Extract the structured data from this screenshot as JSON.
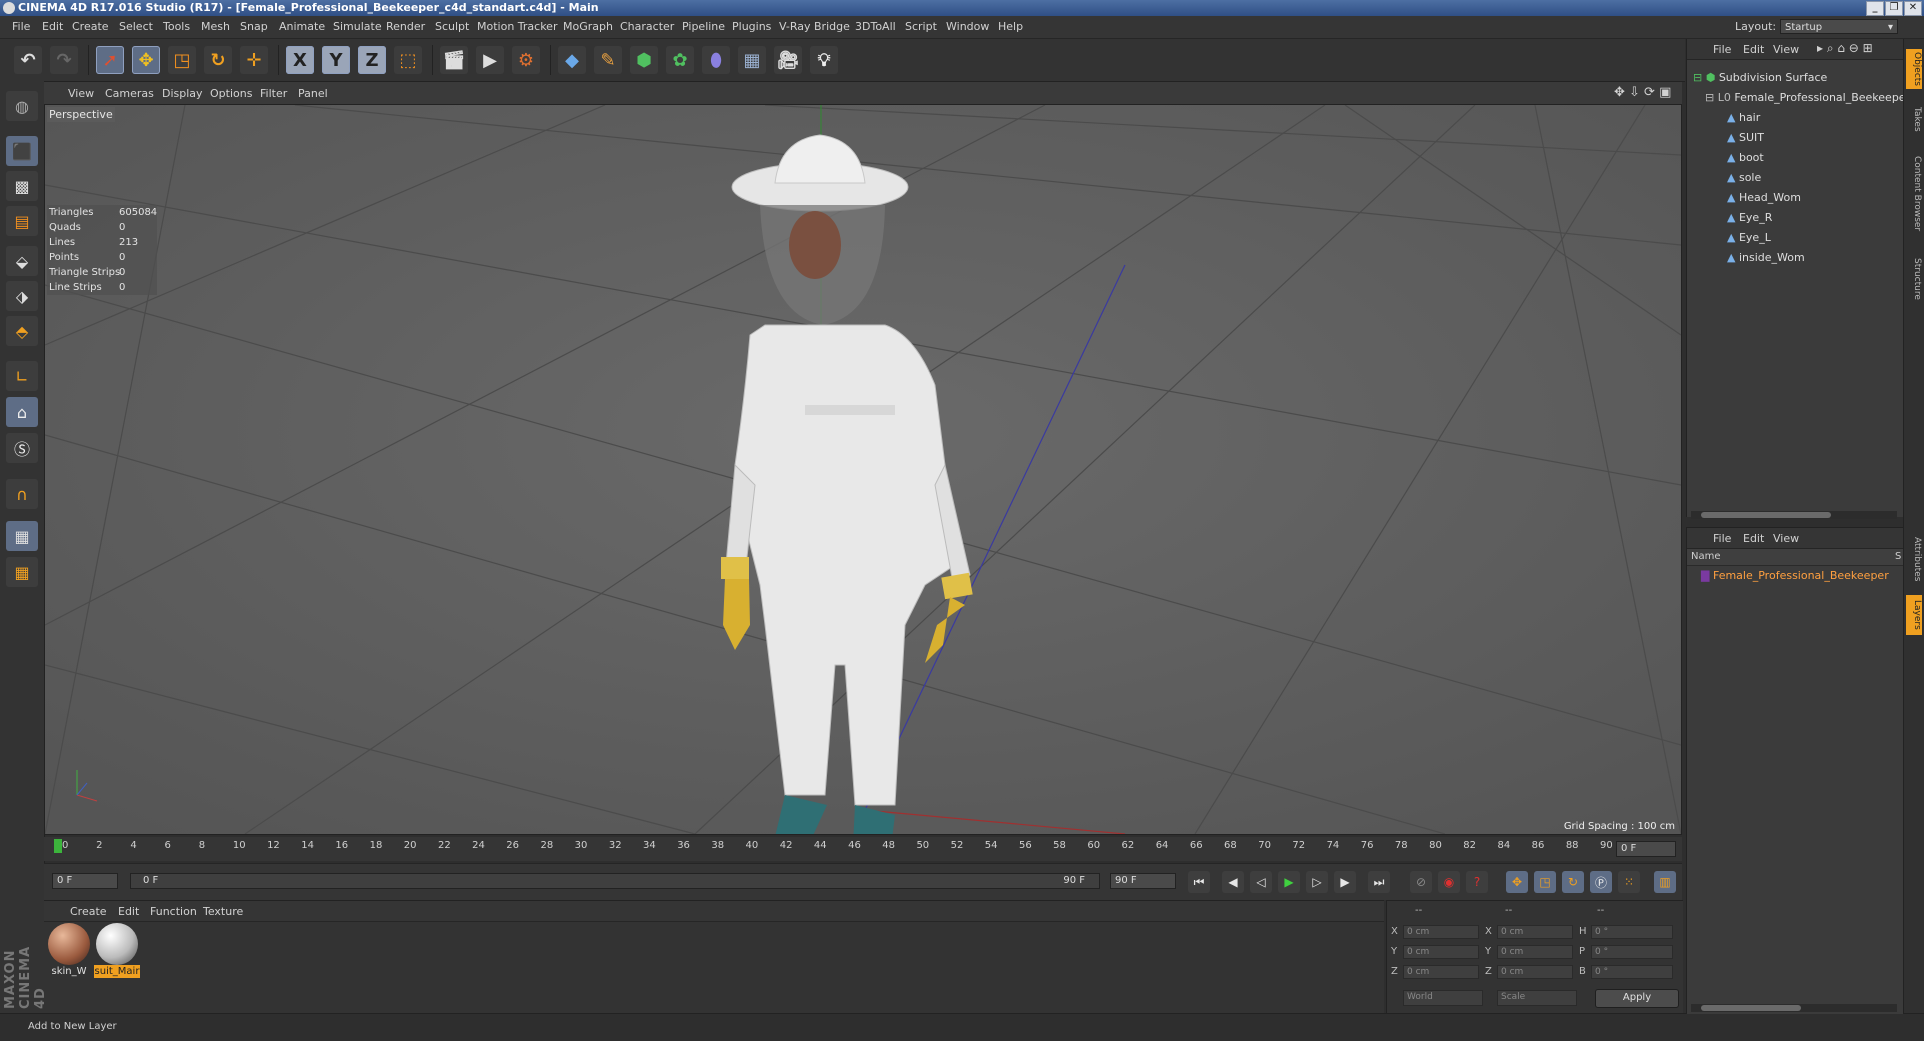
{
  "window": {
    "title": "CINEMA 4D R17.016 Studio (R17) - [Female_Professional_Beekeeper_c4d_standart.c4d] - Main",
    "buttons": [
      "_",
      "❐",
      "✕"
    ]
  },
  "menubar": {
    "items": [
      "File",
      "Edit",
      "Create",
      "Select",
      "Tools",
      "Mesh",
      "Snap",
      "Animate",
      "Simulate",
      "Render",
      "Sculpt",
      "Motion Tracker",
      "MoGraph",
      "Character",
      "Pipeline",
      "Plugins",
      "V-Ray Bridge",
      "3DToAll",
      "Script",
      "Window",
      "Help"
    ],
    "layout_label": "Layout:",
    "layout_value": "Startup"
  },
  "toolbar": {
    "axis_x": "X",
    "axis_y": "Y",
    "axis_z": "Z"
  },
  "viewport": {
    "menu": [
      "View",
      "Cameras",
      "Display",
      "Options",
      "Filter",
      "Panel"
    ],
    "label": "Perspective",
    "stats": [
      {
        "k": "Triangles",
        "v": "605084"
      },
      {
        "k": "Quads",
        "v": "0"
      },
      {
        "k": "Lines",
        "v": "213"
      },
      {
        "k": "Points",
        "v": "0"
      },
      {
        "k": "Triangle Strips",
        "v": "0"
      },
      {
        "k": "Line Strips",
        "v": "0"
      }
    ],
    "grid_spacing": "Grid Spacing : 100 cm"
  },
  "timeline": {
    "ticks": [
      "0",
      "2",
      "4",
      "6",
      "8",
      "10",
      "12",
      "14",
      "16",
      "18",
      "20",
      "22",
      "24",
      "26",
      "28",
      "30",
      "32",
      "34",
      "36",
      "38",
      "40",
      "42",
      "44",
      "46",
      "48",
      "50",
      "52",
      "54",
      "56",
      "58",
      "60",
      "62",
      "64",
      "66",
      "68",
      "70",
      "72",
      "74",
      "76",
      "78",
      "80",
      "82",
      "84",
      "86",
      "88",
      "90"
    ],
    "current_frame": "0 F",
    "start_field": "0 F",
    "range_start": "0 F",
    "range_end": "90 F",
    "end_field": "90 F"
  },
  "material_manager": {
    "menu": [
      "Create",
      "Edit",
      "Function",
      "Texture"
    ],
    "materials": [
      {
        "name": "skin_W",
        "selected": false,
        "color": "#b06a4a"
      },
      {
        "name": "suit_Mair",
        "selected": true,
        "color": "#d8d8d8"
      }
    ]
  },
  "coordinates": {
    "headers": [
      "--",
      "--",
      "--"
    ],
    "rows": [
      {
        "a": "X",
        "av": "0 cm",
        "b": "X",
        "bv": "0 cm",
        "c": "H",
        "cv": "0 °"
      },
      {
        "a": "Y",
        "av": "0 cm",
        "b": "Y",
        "bv": "0 cm",
        "c": "P",
        "cv": "0 °"
      },
      {
        "a": "Z",
        "av": "0 cm",
        "b": "Z",
        "bv": "0 cm",
        "c": "B",
        "cv": "0 °"
      }
    ],
    "mode1": "World",
    "mode2": "Scale",
    "apply": "Apply"
  },
  "status": {
    "text": "Add to New Layer"
  },
  "object_manager": {
    "menu": [
      "File",
      "Edit",
      "View"
    ],
    "items": [
      {
        "name": "Subdivision Surface",
        "level": 0
      },
      {
        "name": "Female_Professional_Beekeeper",
        "level": 1
      },
      {
        "name": "hair",
        "level": 2
      },
      {
        "name": "SUIT",
        "level": 2
      },
      {
        "name": "boot",
        "level": 2
      },
      {
        "name": "sole",
        "level": 2
      },
      {
        "name": "Head_Wom",
        "level": 2
      },
      {
        "name": "Eye_R",
        "level": 2
      },
      {
        "name": "Eye_L",
        "level": 2
      },
      {
        "name": "inside_Wom",
        "level": 2
      }
    ]
  },
  "layer_manager": {
    "menu": [
      "File",
      "Edit",
      "View"
    ],
    "column": "Name",
    "col_s": "S",
    "layer": "Female_Professional_Beekeeper"
  },
  "side_tabs": [
    "Objects",
    "Takes",
    "Content Browser",
    "Structure",
    "Attributes",
    "Layers"
  ],
  "brand": "MAXON CINEMA 4D",
  "colors": {
    "accent": "#ffa040",
    "selected_mat": "#f0a020",
    "layer_text": "#ffa040"
  }
}
